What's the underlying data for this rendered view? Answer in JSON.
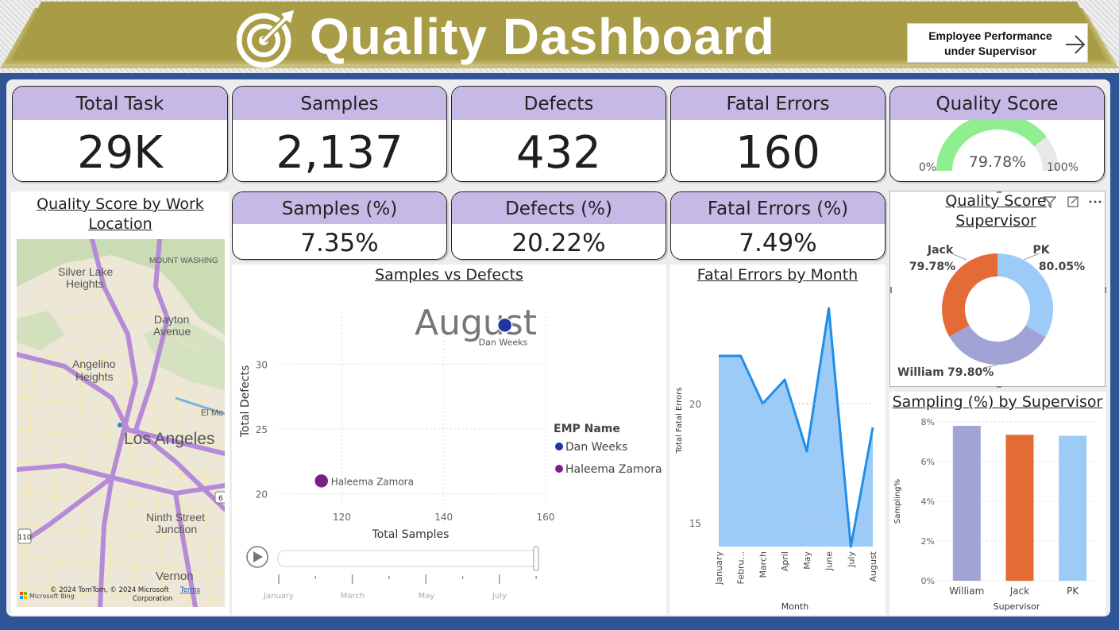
{
  "header": {
    "title": "Quality Dashboard",
    "nav_button": {
      "line1": "Employee Performance",
      "line2": "under Supervisor",
      "icon": "arrow-right-icon"
    },
    "icon": "target-icon",
    "banner_color": "#a89c46"
  },
  "kpis": {
    "total_task": {
      "label": "Total Task",
      "value": "29K"
    },
    "samples": {
      "label": "Samples",
      "value": "2,137"
    },
    "defects": {
      "label": "Defects",
      "value": "432"
    },
    "fatal_errors": {
      "label": "Fatal Errors",
      "value": "160"
    },
    "quality_score": {
      "label": "Quality Score",
      "value": "79.78%",
      "min": "0%",
      "max": "100%",
      "fraction": 0.7978
    },
    "samples_pct": {
      "label": "Samples (%)",
      "value": "7.35%"
    },
    "defects_pct": {
      "label": "Defects (%)",
      "value": "20.22%"
    },
    "fatal_errors_pct": {
      "label": "Fatal Errors (%)",
      "value": "7.49%"
    }
  },
  "map_panel": {
    "title_line1": "Quality Score by Work",
    "title_line2": "Location",
    "places": [
      "Silver Lake",
      "Heights",
      "MOUNT WASHING",
      "Dayton",
      "Avenue",
      "Angelino",
      "Heights",
      "Los Angeles",
      "El Mo",
      "Ninth Street",
      "Junction",
      "Vernon"
    ],
    "copyright": "© 2024 TomTom, © 2024 Microsoft",
    "corporation": "Corporation",
    "terms": "Terms",
    "bing": "Microsoft Bing",
    "route_shield": "110",
    "route_shield2": "6"
  },
  "scatter_panel": {
    "title": "Samples vs Defects",
    "play_icon": "play-icon",
    "timeline_labels": [
      "January",
      "March",
      "May",
      "July"
    ]
  },
  "line_panel": {
    "title": "Fatal Errors by Month"
  },
  "donut_panel": {
    "title_line1": "Quality Score",
    "title_line2": "Supervisor",
    "filter_icon": "filter-icon",
    "focus_icon": "focus-mode-icon",
    "more_icon": "more-options-icon",
    "labels": [
      {
        "name": "Jack",
        "value": "79.78%"
      },
      {
        "name": "PK",
        "value": "80.05%"
      },
      {
        "name": "William",
        "value": "79.80%"
      }
    ]
  },
  "bar_panel": {
    "title": "Sampling (%) by Supervisor"
  },
  "chart_data": [
    {
      "type": "scatter",
      "play_axis_value": "August",
      "xlabel": "Total Samples",
      "ylabel": "Total Defects",
      "xticks": [
        120,
        140,
        160
      ],
      "yticks": [
        20,
        25,
        30
      ],
      "xlim": [
        107,
        160
      ],
      "ylim": [
        19,
        34
      ],
      "legend_title": "EMP Name",
      "legend_position": "right",
      "series": [
        {
          "name": "Dan Weeks",
          "x": 152,
          "y": 33,
          "color": "#2135a3"
        },
        {
          "name": "Haleema Zamora",
          "x": 116,
          "y": 21,
          "color": "#7b1e88"
        }
      ]
    },
    {
      "type": "area",
      "xlabel": "Month",
      "ylabel": "Total Fatal Errors",
      "categories": [
        "January",
        "February",
        "March",
        "April",
        "May",
        "June",
        "July",
        "August"
      ],
      "tick_labels": [
        "January",
        "Febru...",
        "March",
        "April",
        "May",
        "June",
        "July",
        "August"
      ],
      "yticks": [
        15,
        20
      ],
      "ylim": [
        14,
        24.5
      ],
      "values": [
        22,
        22,
        20,
        21,
        18,
        24,
        14,
        19
      ],
      "line_color": "#1f8ee8",
      "fill_color": "#9ccbf7"
    },
    {
      "type": "pie",
      "donut": true,
      "series": [
        {
          "name": "PK",
          "value": 80.05,
          "color": "#9ccbf7"
        },
        {
          "name": "William",
          "value": 79.8,
          "color": "#a1a2d6"
        },
        {
          "name": "Jack",
          "value": 79.78,
          "color": "#e46a36"
        }
      ]
    },
    {
      "type": "bar",
      "xlabel": "Supervisor",
      "ylabel": "Sampling%",
      "categories": [
        "William",
        "Jack",
        "PK"
      ],
      "values": [
        7.8,
        7.35,
        7.3
      ],
      "colors": [
        "#a1a2d6",
        "#e46a36",
        "#9ccbf7"
      ],
      "yticks": [
        "0%",
        "2%",
        "4%",
        "6%",
        "8%"
      ],
      "ylim": [
        0,
        8
      ]
    }
  ]
}
